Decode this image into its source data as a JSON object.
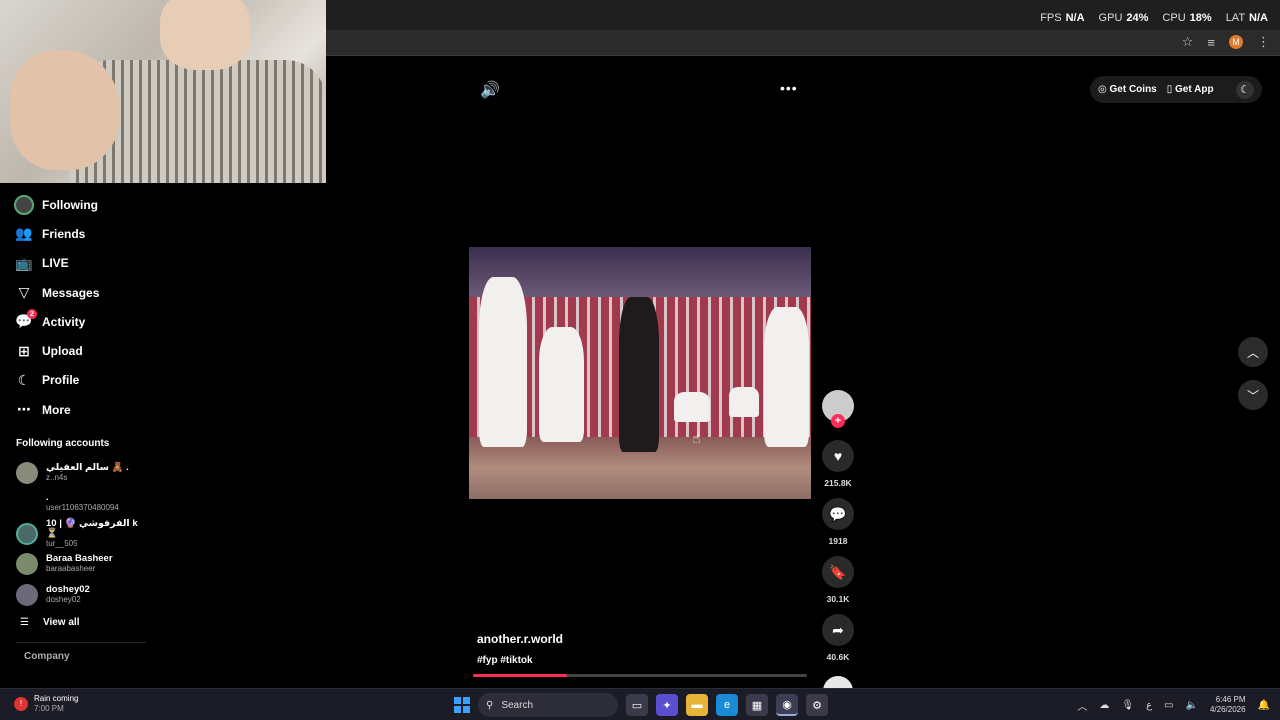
{
  "perf": {
    "fps_label": "FPS",
    "fps_value": "N/A",
    "gpu_label": "GPU",
    "gpu_value": "24%",
    "cpu_label": "CPU",
    "cpu_value": "18%",
    "lat_label": "LAT",
    "lat_value": "N/A"
  },
  "browser": {
    "profile_initial": "M"
  },
  "sidebar": {
    "items": [
      {
        "label": "Following",
        "icon": "following-avatar"
      },
      {
        "label": "Friends",
        "icon": "friends-icon"
      },
      {
        "label": "LIVE",
        "icon": "live-icon"
      },
      {
        "label": "Messages",
        "icon": "messages-icon"
      },
      {
        "label": "Activity",
        "icon": "activity-icon",
        "badge": "2"
      },
      {
        "label": "Upload",
        "icon": "upload-icon"
      },
      {
        "label": "Profile",
        "icon": "profile-icon"
      },
      {
        "label": "More",
        "icon": "more-icon"
      }
    ],
    "following_title": "Following accounts",
    "accounts": [
      {
        "name": "سالم العفيلي 🧸 .",
        "handle": "z..n4s"
      },
      {
        "name": ".",
        "handle": "user1106370480094"
      },
      {
        "name": "10 | 🔮 الفرفوشي k ⏳",
        "handle": "tur__505"
      },
      {
        "name": "Baraa Basheer",
        "handle": "baraabasheer"
      },
      {
        "name": "doshey02",
        "handle": "doshey02"
      }
    ],
    "view_all": "View all",
    "company": "Company"
  },
  "top_actions": {
    "coins": "Get Coins",
    "app": "Get App"
  },
  "video": {
    "author": "another.r.world",
    "tags": "#fyp #tiktok",
    "progress": 0.28,
    "likes": "215.8K",
    "comments": "1918",
    "saves": "30.1K",
    "shares": "40.6K"
  },
  "taskbar": {
    "weather_title": "Rain coming",
    "weather_time": "7:00 PM",
    "search": "Search",
    "time": "6:46 PM",
    "date": "4/26/2026",
    "lang": "ع"
  },
  "colors": {
    "accent": "#fe2c55",
    "bg": "#000000"
  }
}
